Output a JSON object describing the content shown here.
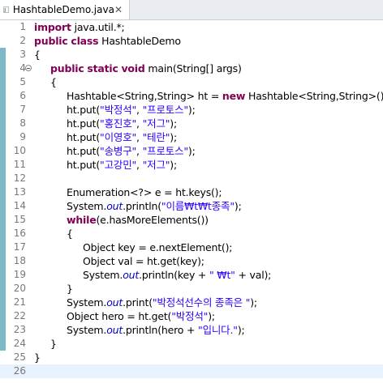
{
  "tab": {
    "label": "HashtableDemo.java",
    "close": "✕"
  },
  "current_line": 26,
  "colors": {
    "keyword": "#7f0055",
    "string": "#2a00ff",
    "static_field": "#0000c0",
    "line_number": "#787878"
  },
  "lines": [
    {
      "num": "1",
      "indent": 0,
      "tokens": [
        {
          "t": "import",
          "k": "kw"
        },
        {
          "t": " java.util.*;"
        }
      ]
    },
    {
      "num": "2",
      "indent": 0,
      "tokens": [
        {
          "t": "public",
          "k": "kw"
        },
        {
          "t": " "
        },
        {
          "t": "class",
          "k": "kw"
        },
        {
          "t": " HashtableDemo"
        }
      ]
    },
    {
      "num": "3",
      "indent": 0,
      "tokens": [
        {
          "t": "{"
        }
      ]
    },
    {
      "num": "4",
      "indent": 1,
      "fold": true,
      "tokens": [
        {
          "t": "public",
          "k": "kw"
        },
        {
          "t": " "
        },
        {
          "t": "static",
          "k": "kw"
        },
        {
          "t": " "
        },
        {
          "t": "void",
          "k": "kw"
        },
        {
          "t": " main(String[] args)"
        }
      ]
    },
    {
      "num": "5",
      "indent": 1,
      "tokens": [
        {
          "t": "{"
        }
      ]
    },
    {
      "num": "6",
      "indent": 2,
      "tokens": [
        {
          "t": "Hashtable<String,String> ht = "
        },
        {
          "t": "new",
          "k": "kw"
        },
        {
          "t": " Hashtable<String,String>();"
        }
      ]
    },
    {
      "num": "7",
      "indent": 2,
      "tokens": [
        {
          "t": "ht.put("
        },
        {
          "t": "\"박정석\"",
          "k": "str"
        },
        {
          "t": ", "
        },
        {
          "t": "\"프로토스\"",
          "k": "str"
        },
        {
          "t": ");"
        }
      ]
    },
    {
      "num": "8",
      "indent": 2,
      "tokens": [
        {
          "t": "ht.put("
        },
        {
          "t": "\"홍진호\"",
          "k": "str"
        },
        {
          "t": ", "
        },
        {
          "t": "\"저그\"",
          "k": "str"
        },
        {
          "t": ");"
        }
      ]
    },
    {
      "num": "9",
      "indent": 2,
      "tokens": [
        {
          "t": "ht.put("
        },
        {
          "t": "\"이영호\"",
          "k": "str"
        },
        {
          "t": ", "
        },
        {
          "t": "\"테란\"",
          "k": "str"
        },
        {
          "t": ");"
        }
      ]
    },
    {
      "num": "10",
      "indent": 2,
      "tokens": [
        {
          "t": "ht.put("
        },
        {
          "t": "\"송병구\"",
          "k": "str"
        },
        {
          "t": ", "
        },
        {
          "t": "\"프로토스\"",
          "k": "str"
        },
        {
          "t": ");"
        }
      ]
    },
    {
      "num": "11",
      "indent": 2,
      "tokens": [
        {
          "t": "ht.put("
        },
        {
          "t": "\"고강민\"",
          "k": "str"
        },
        {
          "t": ", "
        },
        {
          "t": "\"저그\"",
          "k": "str"
        },
        {
          "t": ");"
        }
      ]
    },
    {
      "num": "12",
      "indent": 0,
      "tokens": []
    },
    {
      "num": "13",
      "indent": 2,
      "tokens": [
        {
          "t": "Enumeration<?> e = ht.keys();"
        }
      ]
    },
    {
      "num": "14",
      "indent": 2,
      "tokens": [
        {
          "t": "System."
        },
        {
          "t": "out",
          "k": "st"
        },
        {
          "t": ".println("
        },
        {
          "t": "\"이름₩t₩t종족\"",
          "k": "str"
        },
        {
          "t": ");"
        }
      ]
    },
    {
      "num": "15",
      "indent": 2,
      "tokens": [
        {
          "t": "while",
          "k": "kw"
        },
        {
          "t": "(e.hasMoreElements())"
        }
      ]
    },
    {
      "num": "16",
      "indent": 2,
      "tokens": [
        {
          "t": "{"
        }
      ]
    },
    {
      "num": "17",
      "indent": 3,
      "tokens": [
        {
          "t": "Object key = e.nextElement();"
        }
      ]
    },
    {
      "num": "18",
      "indent": 3,
      "tokens": [
        {
          "t": "Object val = ht.get(key);"
        }
      ]
    },
    {
      "num": "19",
      "indent": 3,
      "tokens": [
        {
          "t": "System."
        },
        {
          "t": "out",
          "k": "st"
        },
        {
          "t": ".println(key + "
        },
        {
          "t": "\" ₩t\"",
          "k": "str"
        },
        {
          "t": " + val);"
        }
      ]
    },
    {
      "num": "20",
      "indent": 2,
      "tokens": [
        {
          "t": "}"
        }
      ]
    },
    {
      "num": "21",
      "indent": 2,
      "tokens": [
        {
          "t": "System."
        },
        {
          "t": "out",
          "k": "st"
        },
        {
          "t": ".print("
        },
        {
          "t": "\"박정석선수의 종족은 \"",
          "k": "str"
        },
        {
          "t": ");"
        }
      ]
    },
    {
      "num": "22",
      "indent": 2,
      "tokens": [
        {
          "t": "Object hero = ht.get("
        },
        {
          "t": "\"박정석\"",
          "k": "str"
        },
        {
          "t": ");"
        }
      ]
    },
    {
      "num": "23",
      "indent": 2,
      "tokens": [
        {
          "t": "System."
        },
        {
          "t": "out",
          "k": "st"
        },
        {
          "t": ".println(hero + "
        },
        {
          "t": "\"입니다.\"",
          "k": "str"
        },
        {
          "t": ");"
        }
      ]
    },
    {
      "num": "24",
      "indent": 1,
      "tokens": [
        {
          "t": "}"
        }
      ]
    },
    {
      "num": "25",
      "indent": 0,
      "tokens": [
        {
          "t": "}"
        }
      ]
    },
    {
      "num": "26",
      "indent": 0,
      "tokens": []
    }
  ]
}
